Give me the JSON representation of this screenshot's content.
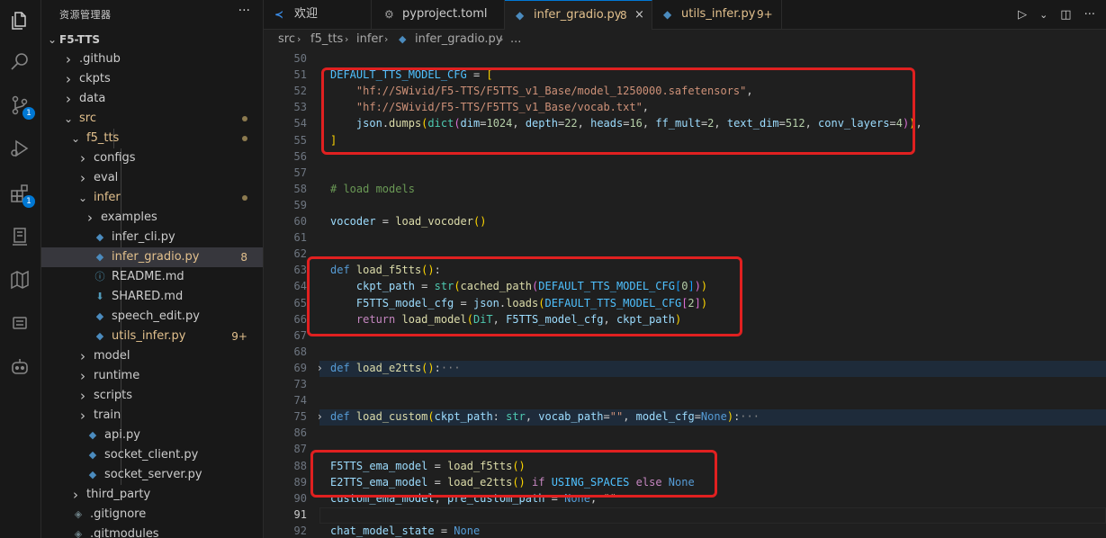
{
  "sidebar": {
    "title": "资源管理器",
    "more_label": "···",
    "root": "F5-TTS",
    "items": [
      {
        "label": ".github",
        "kind": "folder",
        "deco": ""
      },
      {
        "label": "ckpts",
        "kind": "folder",
        "deco": ""
      },
      {
        "label": "data",
        "kind": "folder",
        "deco": ""
      },
      {
        "label": "src",
        "kind": "folder-open",
        "deco": "dot"
      },
      {
        "label": "f5_tts",
        "kind": "folder-open",
        "deco": "dot"
      },
      {
        "label": "configs",
        "kind": "folder",
        "deco": ""
      },
      {
        "label": "eval",
        "kind": "folder",
        "deco": ""
      },
      {
        "label": "infer",
        "kind": "folder-open",
        "deco": "dot"
      },
      {
        "label": "examples",
        "kind": "folder",
        "deco": ""
      },
      {
        "label": "infer_cli.py",
        "kind": "py",
        "deco": ""
      },
      {
        "label": "infer_gradio.py",
        "kind": "py",
        "deco": "8"
      },
      {
        "label": "README.md",
        "kind": "info",
        "deco": ""
      },
      {
        "label": "SHARED.md",
        "kind": "md",
        "deco": ""
      },
      {
        "label": "speech_edit.py",
        "kind": "py",
        "deco": ""
      },
      {
        "label": "utils_infer.py",
        "kind": "py",
        "deco": "9+"
      },
      {
        "label": "model",
        "kind": "folder",
        "deco": ""
      },
      {
        "label": "runtime",
        "kind": "folder",
        "deco": ""
      },
      {
        "label": "scripts",
        "kind": "folder",
        "deco": ""
      },
      {
        "label": "train",
        "kind": "folder",
        "deco": ""
      },
      {
        "label": "api.py",
        "kind": "py",
        "deco": ""
      },
      {
        "label": "socket_client.py",
        "kind": "py",
        "deco": ""
      },
      {
        "label": "socket_server.py",
        "kind": "py",
        "deco": ""
      },
      {
        "label": "third_party",
        "kind": "folder",
        "deco": ""
      },
      {
        "label": ".gitignore",
        "kind": "git",
        "deco": ""
      },
      {
        "label": ".gitmodules",
        "kind": "git",
        "deco": ""
      }
    ]
  },
  "activity": {
    "scm_badge": "1",
    "ext_badge": "1"
  },
  "tabs": [
    {
      "label": "欢迎",
      "badge": ""
    },
    {
      "label": "pyproject.toml",
      "badge": ""
    },
    {
      "label": "infer_gradio.py",
      "badge": "8"
    },
    {
      "label": "utils_infer.py",
      "badge": "9+"
    }
  ],
  "tab_close": "×",
  "breadcrumb": [
    "src",
    "f5_tts",
    "infer",
    "infer_gradio.py",
    "..."
  ],
  "breadcrumb_sep": "›",
  "colors": {
    "highlight_box": "#e02020",
    "accent": "#0078d4",
    "modified": "#e2c08d"
  },
  "editor": {
    "line_numbers": [
      "50",
      "51",
      "52",
      "53",
      "54",
      "55",
      "56",
      "57",
      "58",
      "59",
      "60",
      "61",
      "62",
      "63",
      "64",
      "65",
      "66",
      "67",
      "68",
      "69",
      "73",
      "74",
      "75",
      "86",
      "87",
      "88",
      "89",
      "90",
      "91",
      "92"
    ],
    "lines": [
      "",
      "DEFAULT_TTS_MODEL_CFG = [",
      "    \"hf://SWivid/F5-TTS/F5TTS_v1_Base/model_1250000.safetensors\",",
      "    \"hf://SWivid/F5-TTS/F5TTS_v1_Base/vocab.txt\",",
      "    json.dumps(dict(dim=1024, depth=22, heads=16, ff_mult=2, text_dim=512, conv_layers=4)),",
      "]",
      "",
      "",
      "# load models",
      "",
      "vocoder = load_vocoder()",
      "",
      "",
      "def load_f5tts():",
      "    ckpt_path = str(cached_path(DEFAULT_TTS_MODEL_CFG[0]))",
      "    F5TTS_model_cfg = json.loads(DEFAULT_TTS_MODEL_CFG[2])",
      "    return load_model(DiT, F5TTS_model_cfg, ckpt_path)",
      "",
      "",
      "def load_e2tts():···",
      "",
      "",
      "def load_custom(ckpt_path: str, vocab_path=\"\", model_cfg=None):···",
      "",
      "",
      "F5TTS_ema_model = load_f5tts()",
      "E2TTS_ema_model = load_e2tts() if USING_SPACES else None",
      "custom_ema_model, pre_custom_path = None, \"\"",
      "",
      "chat_model_state = None"
    ]
  }
}
